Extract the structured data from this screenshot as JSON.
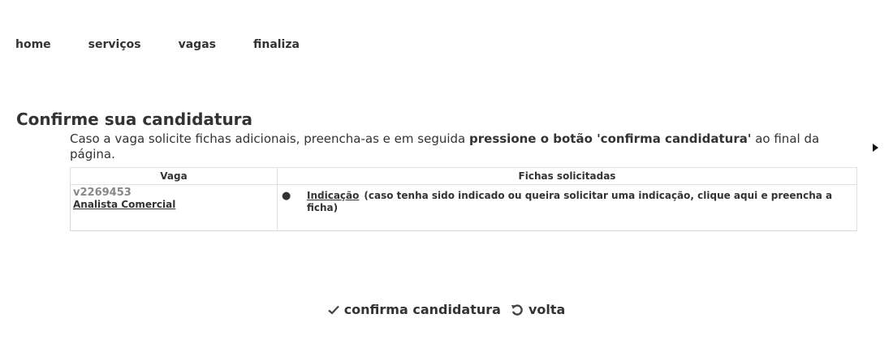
{
  "nav": {
    "items": [
      {
        "label": "home"
      },
      {
        "label": "serviços"
      },
      {
        "label": "vagas"
      },
      {
        "label": "finaliza"
      }
    ]
  },
  "main": {
    "title": "Confirme sua candidatura",
    "intro_prefix": "Caso a vaga solicite fichas adicionais, preencha-as e em seguida ",
    "intro_bold": "pressione o botão 'confirma candidatura'",
    "intro_suffix": " ao final da página."
  },
  "table": {
    "headers": [
      "Vaga",
      "Fichas solicitadas"
    ],
    "rows": [
      {
        "vaga_id": "v2269453",
        "vaga_title": "Analista Comercial",
        "ficha_link": "Indicação",
        "ficha_note": "(caso tenha sido indicado ou queira solicitar uma indicação, clique aqui e preencha a ficha)"
      }
    ]
  },
  "actions": {
    "confirm_label": "confirma candidatura",
    "back_label": "volta",
    "confirm_icon": "checkmark-icon",
    "back_icon": "undo-icon"
  }
}
